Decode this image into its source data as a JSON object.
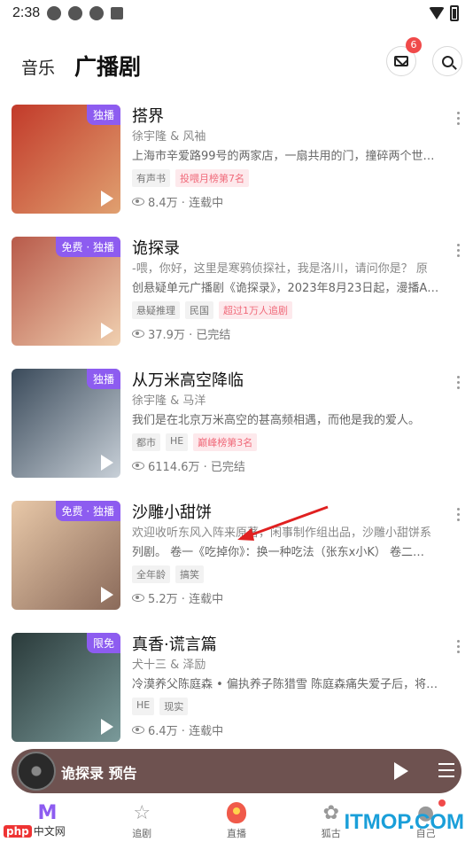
{
  "status": {
    "time": "2:38"
  },
  "header": {
    "tab_music": "音乐",
    "tab_drama": "广播剧",
    "mail_badge": "6"
  },
  "items": [
    {
      "title": "搭界",
      "sub": "徐宇隆 & 风袖",
      "desc": "上海市辛爱路99号的两家店，一扇共用的门，撞碎两个世…",
      "tags": [
        {
          "text": "有声书",
          "hot": false
        },
        {
          "text": "投喂月榜第7名",
          "hot": true
        }
      ],
      "views": "8.4万 · 连载中",
      "badge": "独播",
      "colors": [
        "#c23a2a",
        "#e0a070"
      ]
    },
    {
      "title": "诡探录",
      "sub": "-喂，你好，这里是寒鸦侦探社，我是洛川，请问你是？ 原",
      "desc": "创悬疑单元广播剧《诡探录》，2023年8月23日起，漫播A…",
      "tags": [
        {
          "text": "悬疑推理",
          "hot": false
        },
        {
          "text": "民国",
          "hot": false
        },
        {
          "text": "超过1万人追剧",
          "hot": true
        }
      ],
      "views": "37.9万 · 已完结",
      "badge": "免费 · 独播",
      "colors": [
        "#b85a4a",
        "#f0d0b0"
      ]
    },
    {
      "title": "从万米高空降临",
      "sub": "徐宇隆 & 马洋",
      "desc": "我们是在北京万米高空的甚高频相遇，而他是我的爱人。",
      "tags": [
        {
          "text": "都市",
          "hot": false
        },
        {
          "text": "HE",
          "hot": false
        },
        {
          "text": "巅峰榜第3名",
          "hot": true
        }
      ],
      "views": "6114.6万 · 已完结",
      "badge": "独播",
      "colors": [
        "#3a4a5a",
        "#c8d0d8"
      ]
    },
    {
      "title": "沙雕小甜饼",
      "sub": "欢迎收听东风入阵来原著，闲事制作组出品，沙雕小甜饼系",
      "desc": "列剧。 卷一《吃掉你》：换一种吃法（张东x小K） 卷二…",
      "tags": [
        {
          "text": "全年龄",
          "hot": false
        },
        {
          "text": "搞笑",
          "hot": false
        }
      ],
      "views": "5.2万 · 连载中",
      "badge": "免费 · 独播",
      "colors": [
        "#e8c8a8",
        "#8a6a5a"
      ]
    },
    {
      "title": "真香·谎言篇",
      "sub": "犬十三 & 泽励",
      "desc": "冷漠养父陈庭森 • 偏执养子陈猎雪 陈庭森痛失爱子后，将…",
      "tags": [
        {
          "text": "HE",
          "hot": false
        },
        {
          "text": "现实",
          "hot": false
        }
      ],
      "views": "6.4万 · 连载中",
      "badge": "限免",
      "colors": [
        "#2a3a3a",
        "#7a9a9a"
      ]
    }
  ],
  "player": {
    "title": "诡探录 预告"
  },
  "tabbar": [
    {
      "label": "",
      "icon": "m-logo-icon"
    },
    {
      "label": "追剧",
      "icon": "star-icon"
    },
    {
      "label": "直播",
      "icon": "live-icon"
    },
    {
      "label": "狐古",
      "icon": "fox-icon"
    },
    {
      "label": "自己",
      "icon": "avatar-icon"
    }
  ],
  "watermark": {
    "right": "ITMOP.COM",
    "left_tag": "php",
    "left_text": "中文网"
  }
}
